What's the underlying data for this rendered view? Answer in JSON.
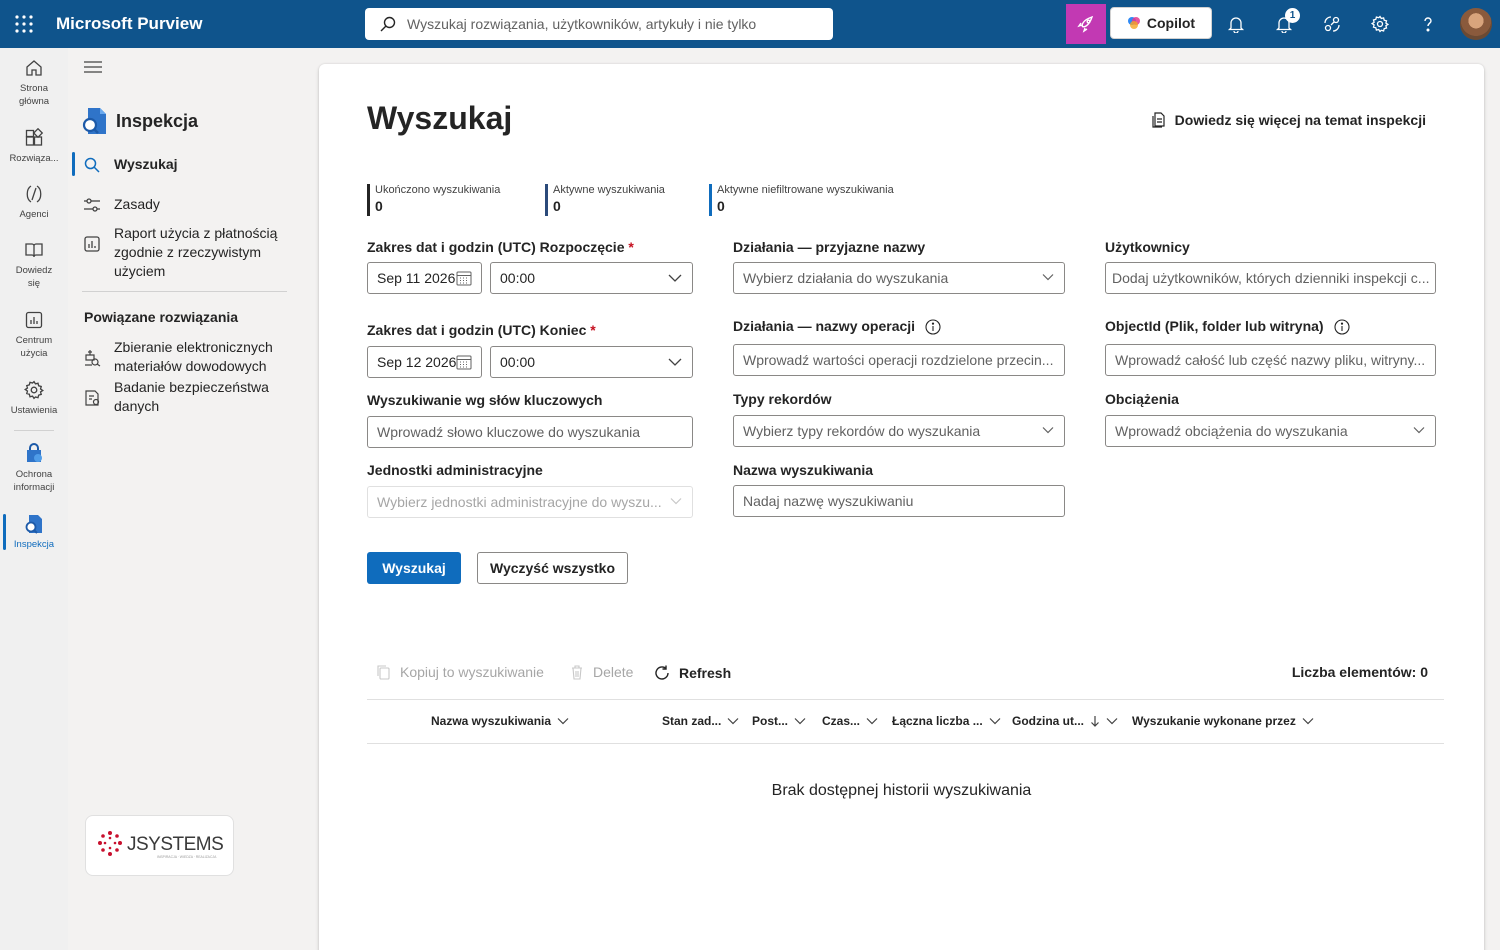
{
  "app": {
    "title": "Microsoft Purview"
  },
  "search": {
    "placeholder": "Wyszukaj rozwiązania, użytkowników, artykuły i nie tylko"
  },
  "topbar": {
    "copilot_label": "Copilot",
    "notification_count": "1",
    "accent": "#c239b3"
  },
  "rail": {
    "items": [
      {
        "label": "Strona główna",
        "icon": "home-icon"
      },
      {
        "label": "Rozwiąza...",
        "icon": "solutions-icon"
      },
      {
        "label": "Agenci",
        "icon": "agents-icon"
      },
      {
        "label": "Dowiedz się",
        "icon": "book-icon"
      },
      {
        "label": "Centrum użycia",
        "icon": "chart-icon"
      },
      {
        "label": "Ustawienia",
        "icon": "gear-icon"
      },
      {
        "label": "Ochrona informacji",
        "icon": "shield-lock-icon"
      },
      {
        "label": "Inspekcja",
        "icon": "audit-icon"
      }
    ]
  },
  "nav": {
    "header": "Inspekcja",
    "items": [
      {
        "label": "Wyszukaj",
        "icon": "search-icon"
      },
      {
        "label": "Zasady",
        "icon": "sliders-icon"
      },
      {
        "label": "Raport użycia z płatnością zgodnie z rzeczywistym użyciem",
        "icon": "report-icon"
      }
    ],
    "related_header": "Powiązane rozwiązania",
    "related": [
      {
        "label": "Zbieranie elektronicznych materiałów dowodowych",
        "icon": "ediscovery-icon"
      },
      {
        "label": "Badanie bezpieczeństwa danych",
        "icon": "investigation-icon"
      }
    ]
  },
  "logo": {
    "text": "JSystems",
    "tagline": "INSPIRACJA · WIEDZA · REALIZACJA"
  },
  "page": {
    "title": "Wyszukaj",
    "learn_more": "Dowiedz się więcej na temat inspekcji"
  },
  "stats": [
    {
      "label": "Ukończono wyszukiwania",
      "value": "0",
      "color": "#242424"
    },
    {
      "label": "Aktywne wyszukiwania",
      "value": "0",
      "color": "#2b4a7a"
    },
    {
      "label": "Aktywne niefiltrowane wyszukiwania",
      "value": "0",
      "color": "#0f6cbd"
    }
  ],
  "form": {
    "start_label": "Zakres dat i godzin (UTC) Rozpoczęcie",
    "start_date": "Sep 11 2026",
    "start_time": "00:00",
    "end_label": "Zakres dat i godzin (UTC) Koniec",
    "end_date": "Sep 12 2026",
    "end_time": "00:00",
    "required_mark": "*",
    "keyword_label": "Wyszukiwanie wg słów kluczowych",
    "keyword_placeholder": "Wprowadź słowo kluczowe do wyszukania",
    "admin_units_label": "Jednostki administracyjne",
    "admin_units_placeholder": "Wybierz jednostki administracyjne do wyszu...",
    "activities_friendly_label": "Działania — przyjazne nazwy",
    "activities_friendly_placeholder": "Wybierz działania do wyszukania",
    "activities_ops_label": "Działania — nazwy operacji",
    "activities_ops_placeholder": "Wprowadź wartości operacji rozdzielone przecin...",
    "record_types_label": "Typy rekordów",
    "record_types_placeholder": "Wybierz typy rekordów do wyszukania",
    "search_name_label": "Nazwa wyszukiwania",
    "search_name_placeholder": "Nadaj nazwę wyszukiwaniu",
    "users_label": "Użytkownicy",
    "users_placeholder": "Dodaj użytkowników, których dzienniki inspekcji c...",
    "objectid_label": "ObjectId (Plik, folder lub witryna)",
    "objectid_placeholder": "Wprowadź całość lub część nazwy pliku, witryny...",
    "workloads_label": "Obciążenia",
    "workloads_placeholder": "Wprowadź obciążenia do wyszukania",
    "search_button": "Wyszukaj",
    "clear_button": "Wyczyść wszystko"
  },
  "commands": {
    "copy": "Kopiuj to wyszukiwanie",
    "delete": "Delete",
    "refresh": "Refresh",
    "count": "Liczba elementów: 0"
  },
  "table": {
    "columns": [
      "Nazwa wyszukiwania",
      "Stan zad...",
      "Post...",
      "Czas...",
      "Łączna liczba ...",
      "Godzina ut...",
      "Wyszukanie wykonane przez"
    ],
    "empty": "Brak dostępnej historii wyszukiwania"
  }
}
